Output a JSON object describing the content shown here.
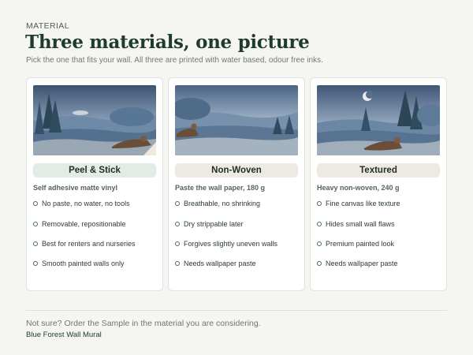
{
  "header": {
    "eyebrow": "MATERIAL",
    "title": "Three materials, one picture",
    "subtitle": "Pick the one that fits your wall. All three are printed with water based, odour free inks."
  },
  "cards": [
    {
      "name": "Peel & Stick",
      "pill_color": "#e3ebe6",
      "description": "Self adhesive matte vinyl",
      "features": [
        "No paste, no water, no tools",
        "Removable, repositionable",
        "Best for renters and nurseries",
        "Smooth painted walls only"
      ]
    },
    {
      "name": "Non-Woven",
      "pill_color": "#ede9e3",
      "description": "Paste the wall paper, 180 g",
      "features": [
        "Breathable, no shrinking",
        "Dry strippable later",
        "Forgives slightly uneven walls",
        "Needs wallpaper paste"
      ]
    },
    {
      "name": "Textured",
      "pill_color": "#ede9e3",
      "description": "Heavy non-woven, 240 g",
      "features": [
        "Fine canvas like texture",
        "Hides small wall flaws",
        "Premium painted look",
        "Needs wallpaper paste"
      ]
    }
  ],
  "footer": {
    "note": "Not sure? Order the Sample in the material you are considering.",
    "product": "Blue Forest Wall Mural"
  },
  "colors": {
    "background": "#f5f5f2",
    "title": "#1f3a30",
    "card_border": "#e1e3df"
  },
  "icons": [
    "bullet-circle-icon"
  ]
}
